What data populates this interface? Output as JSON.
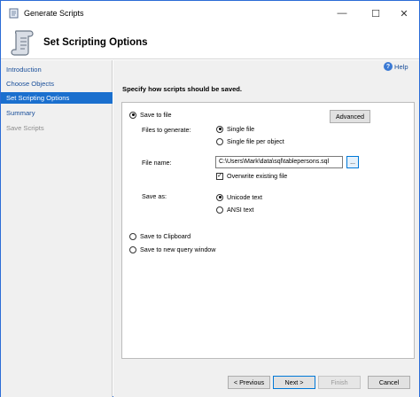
{
  "window": {
    "title": "Generate Scripts"
  },
  "header": {
    "title": "Set Scripting Options"
  },
  "sidebar": {
    "items": [
      {
        "label": "Introduction",
        "state": "link"
      },
      {
        "label": "Choose Objects",
        "state": "link"
      },
      {
        "label": "Set Scripting Options",
        "state": "selected"
      },
      {
        "label": "Summary",
        "state": "link"
      },
      {
        "label": "Save Scripts",
        "state": "disabled"
      }
    ]
  },
  "help": {
    "label": "Help"
  },
  "content": {
    "instruction": "Specify how scripts should be saved.",
    "save_to_file": {
      "label": "Save to file",
      "checked": true
    },
    "advanced_button": "Advanced",
    "files_to_generate": {
      "label": "Files to generate:",
      "options": [
        {
          "label": "Single file",
          "checked": true
        },
        {
          "label": "Single file per object",
          "checked": false
        }
      ]
    },
    "file_name": {
      "label": "File name:",
      "value": "C:\\Users\\Mark\\data\\sql\\tablepersons.sql",
      "browse_label": "..."
    },
    "overwrite": {
      "label": "Overwrite existing file",
      "checked": true
    },
    "save_as": {
      "label": "Save as:",
      "options": [
        {
          "label": "Unicode text",
          "checked": true
        },
        {
          "label": "ANSI text",
          "checked": false
        }
      ]
    },
    "save_to_clipboard": {
      "label": "Save to Clipboard",
      "checked": false
    },
    "save_to_query_window": {
      "label": "Save to new query window",
      "checked": false
    }
  },
  "footer": {
    "previous": "< Previous",
    "next": "Next >",
    "finish": "Finish",
    "cancel": "Cancel"
  },
  "colors": {
    "accent": "#1a6fce",
    "link": "#1a4f9a",
    "window_border": "#2b6cd6"
  }
}
